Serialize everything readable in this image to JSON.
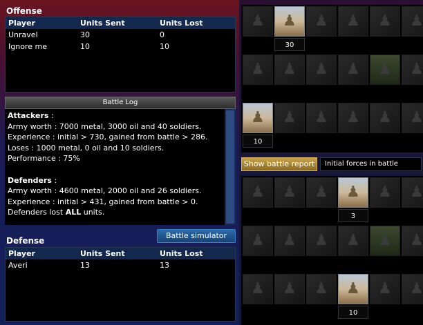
{
  "offense": {
    "title": "Offense",
    "columns": [
      "Player",
      "Units Sent",
      "Units Lost"
    ],
    "rows": [
      {
        "player": "Unravel",
        "sent": "30",
        "lost": "0"
      },
      {
        "player": "Ignore me",
        "sent": "10",
        "lost": "10"
      }
    ]
  },
  "battle_log": {
    "title": "Battle Log",
    "attackers_heading": "Attackers",
    "attackers_suffix": " :",
    "army_worth_a": "Army worth : 7000 metal, 3000 oil and 40 soldiers.",
    "experience_a": "Experience : initial > 730, gained from battle > 286.",
    "loses_a": "Loses : 1000 metal, 0 oil and 10 soldiers.",
    "performance": "Performance : 75%",
    "defenders_heading": "Defenders",
    "defenders_suffix": " :",
    "army_worth_d": "Army worth : 4600 metal, 2000 oil and 26 soldiers.",
    "experience_d": "Experience : initial > 431, gained from battle > 0.",
    "defenders_lost_prefix": "Defenders lost ",
    "defenders_lost_bold": "ALL",
    "defenders_lost_suffix": " units."
  },
  "defense": {
    "title": "Defense",
    "columns": [
      "Player",
      "Units Sent",
      "Units Lost"
    ],
    "rows": [
      {
        "player": "Averi",
        "sent": "13",
        "lost": "13"
      }
    ]
  },
  "buttons": {
    "simulator": "Battle simulator",
    "report": "Show battle report"
  },
  "report_select": {
    "value": "Initial forces in battle"
  },
  "attacker_units": {
    "counts": [
      "",
      "30",
      "",
      "",
      "",
      "",
      "",
      "",
      "",
      "",
      "",
      "",
      "10",
      "",
      "",
      "",
      "",
      ""
    ]
  },
  "defender_units": {
    "counts": [
      "",
      "",
      "",
      "3",
      "",
      "",
      "",
      "",
      "",
      "",
      "",
      "",
      "",
      "",
      "",
      "10",
      "",
      ""
    ]
  }
}
